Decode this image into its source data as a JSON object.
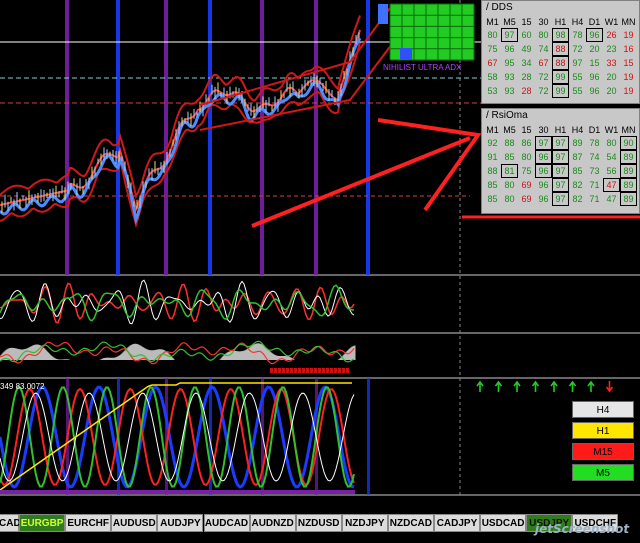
{
  "chart": {
    "indicator_readout": "349 83.0072",
    "nihilist_label": "NIHILIST ULTRA ADX"
  },
  "colors": {
    "price_band_red": "#d01818",
    "price_blue": "#4e8cff",
    "green": "#30c030",
    "purple": "#7a1fa8",
    "vline_blue": "#1a3cff",
    "grid_green": "#22cc22"
  },
  "dds": {
    "title": "/ DDS",
    "headers": [
      "M1",
      "M5",
      "15",
      "30",
      "H1",
      "H4",
      "D1",
      "W1",
      "MN"
    ],
    "rows": [
      [
        [
          "80",
          "g",
          0
        ],
        [
          "97",
          "g",
          1
        ],
        [
          "60",
          "g",
          0
        ],
        [
          "80",
          "g",
          0
        ],
        [
          "98",
          "g",
          1
        ],
        [
          "78",
          "g",
          0
        ],
        [
          "96",
          "g",
          1
        ],
        [
          "26",
          "r",
          0
        ],
        [
          "19",
          "r",
          0
        ]
      ],
      [
        [
          "75",
          "g",
          0
        ],
        [
          "96",
          "g",
          0
        ],
        [
          "49",
          "g",
          0
        ],
        [
          "74",
          "g",
          0
        ],
        [
          "88",
          "r",
          1
        ],
        [
          "72",
          "g",
          0
        ],
        [
          "20",
          "g",
          0
        ],
        [
          "23",
          "g",
          0
        ],
        [
          "16",
          "r",
          0
        ]
      ],
      [
        [
          "67",
          "r",
          0
        ],
        [
          "95",
          "g",
          0
        ],
        [
          "34",
          "g",
          0
        ],
        [
          "67",
          "r",
          0
        ],
        [
          "88",
          "r",
          1
        ],
        [
          "97",
          "g",
          0
        ],
        [
          "15",
          "g",
          0
        ],
        [
          "33",
          "r",
          0
        ],
        [
          "15",
          "r",
          0
        ]
      ],
      [
        [
          "58",
          "g",
          0
        ],
        [
          "93",
          "g",
          0
        ],
        [
          "28",
          "g",
          0
        ],
        [
          "72",
          "g",
          0
        ],
        [
          "99",
          "g",
          1
        ],
        [
          "55",
          "g",
          0
        ],
        [
          "96",
          "g",
          0
        ],
        [
          "20",
          "g",
          0
        ],
        [
          "19",
          "r",
          0
        ]
      ],
      [
        [
          "53",
          "g",
          0
        ],
        [
          "93",
          "g",
          0
        ],
        [
          "28",
          "r",
          0
        ],
        [
          "72",
          "g",
          0
        ],
        [
          "99",
          "g",
          1
        ],
        [
          "55",
          "g",
          0
        ],
        [
          "96",
          "g",
          0
        ],
        [
          "20",
          "g",
          0
        ],
        [
          "19",
          "r",
          0
        ]
      ]
    ]
  },
  "rsioma": {
    "title": "/ RsiOma",
    "headers": [
      "M1",
      "M5",
      "15",
      "30",
      "H1",
      "H4",
      "D1",
      "W1",
      "MN"
    ],
    "rows": [
      [
        [
          "92",
          "g",
          0
        ],
        [
          "88",
          "g",
          0
        ],
        [
          "86",
          "g",
          0
        ],
        [
          "97",
          "g",
          1
        ],
        [
          "97",
          "g",
          1
        ],
        [
          "89",
          "g",
          0
        ],
        [
          "78",
          "g",
          0
        ],
        [
          "80",
          "g",
          0
        ],
        [
          "90",
          "g",
          1
        ]
      ],
      [
        [
          "91",
          "g",
          0
        ],
        [
          "85",
          "g",
          0
        ],
        [
          "80",
          "g",
          0
        ],
        [
          "96",
          "g",
          1
        ],
        [
          "97",
          "g",
          1
        ],
        [
          "87",
          "g",
          0
        ],
        [
          "74",
          "g",
          0
        ],
        [
          "54",
          "g",
          0
        ],
        [
          "89",
          "g",
          1
        ]
      ],
      [
        [
          "88",
          "g",
          0
        ],
        [
          "81",
          "g",
          1
        ],
        [
          "75",
          "g",
          0
        ],
        [
          "96",
          "g",
          1
        ],
        [
          "97",
          "g",
          1
        ],
        [
          "85",
          "g",
          0
        ],
        [
          "73",
          "g",
          0
        ],
        [
          "56",
          "g",
          0
        ],
        [
          "89",
          "g",
          1
        ]
      ],
      [
        [
          "85",
          "g",
          0
        ],
        [
          "80",
          "g",
          0
        ],
        [
          "69",
          "r",
          0
        ],
        [
          "96",
          "g",
          0
        ],
        [
          "97",
          "g",
          1
        ],
        [
          "82",
          "g",
          0
        ],
        [
          "71",
          "g",
          0
        ],
        [
          "47",
          "r",
          1
        ],
        [
          "89",
          "g",
          1
        ]
      ],
      [
        [
          "85",
          "g",
          0
        ],
        [
          "80",
          "g",
          0
        ],
        [
          "69",
          "r",
          0
        ],
        [
          "96",
          "g",
          0
        ],
        [
          "97",
          "g",
          1
        ],
        [
          "82",
          "g",
          0
        ],
        [
          "71",
          "g",
          0
        ],
        [
          "47",
          "g",
          0
        ],
        [
          "89",
          "g",
          1
        ]
      ]
    ]
  },
  "timeframes": [
    {
      "label": "H4",
      "bg": "#e6e6e6",
      "fg": "#000000"
    },
    {
      "label": "H1",
      "bg": "#ffe600",
      "fg": "#000000"
    },
    {
      "label": "M15",
      "bg": "#ff1a1a",
      "fg": "#000000"
    },
    {
      "label": "M5",
      "bg": "#22dd22",
      "fg": "#000000"
    }
  ],
  "arrows": {
    "up_count": 7,
    "down_count": 1
  },
  "tabs": [
    {
      "label": "CAD",
      "state": "normal"
    },
    {
      "label": "EURGBP",
      "state": "active"
    },
    {
      "label": "EURCHF",
      "state": "normal"
    },
    {
      "label": "AUDUSD",
      "state": "normal"
    },
    {
      "label": "AUDJPY",
      "state": "normal"
    },
    {
      "label": "AUDCAD",
      "state": "normal"
    },
    {
      "label": "AUDNZD",
      "state": "normal"
    },
    {
      "label": "NZDUSD",
      "state": "normal"
    },
    {
      "label": "NZDJPY",
      "state": "normal"
    },
    {
      "label": "NZDCAD",
      "state": "normal"
    },
    {
      "label": "CADJPY",
      "state": "normal"
    },
    {
      "label": "USDCAD",
      "state": "normal"
    },
    {
      "label": "USDJPY",
      "state": "dark"
    },
    {
      "label": "USDCHF",
      "state": "normal"
    }
  ],
  "watermark": "jetScreenshot"
}
